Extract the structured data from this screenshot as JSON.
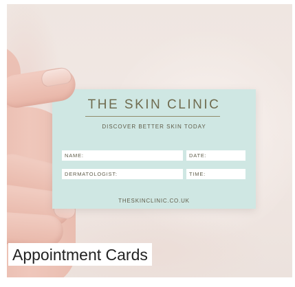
{
  "product_tile": {
    "caption": "Appointment Cards",
    "image_alt": "Hand holding a mint appointment card",
    "card": {
      "title": "THE SKIN CLINIC",
      "tagline": "DISCOVER BETTER SKIN TODAY",
      "fields": {
        "name": "NAME:",
        "date": "DATE:",
        "dermatologist": "DERMATOLOGIST:",
        "time": "TIME:"
      },
      "url": "THESKINCLINIC.CO.UK"
    },
    "colors": {
      "card_background": "#cfe7e3",
      "card_text": "#6f6b4f",
      "caption_text": "#222222"
    }
  }
}
